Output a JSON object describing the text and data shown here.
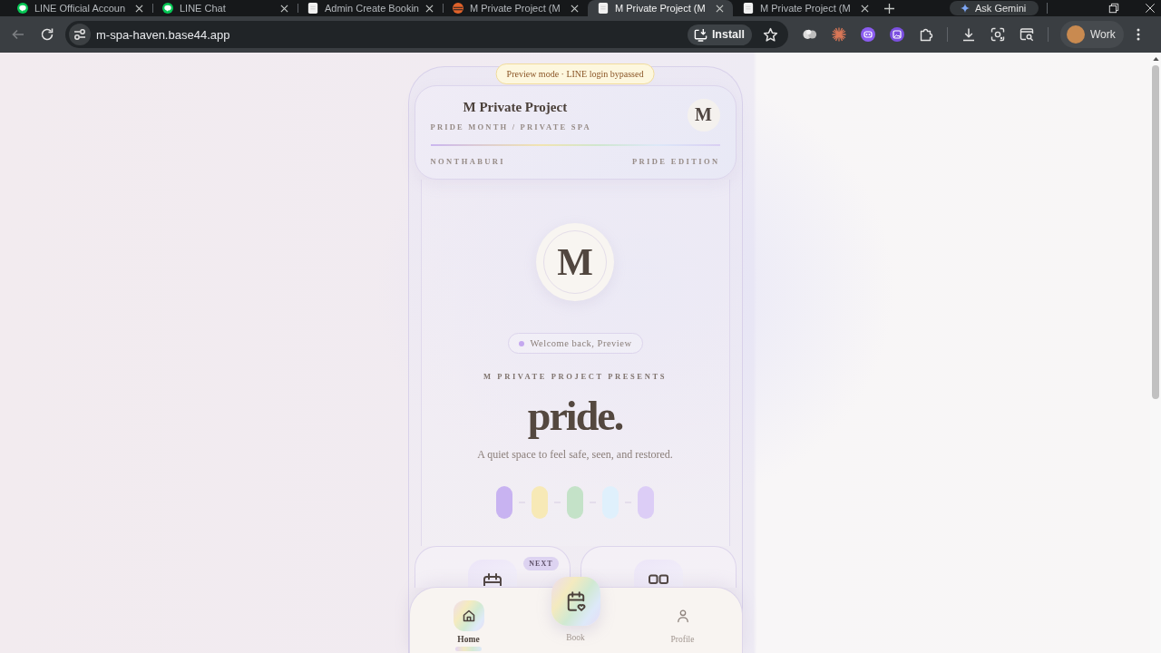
{
  "browser": {
    "tabs": [
      {
        "title": "LINE Official Accoun",
        "kind": "chat",
        "selected": false
      },
      {
        "title": "LINE Chat",
        "kind": "chat",
        "selected": false
      },
      {
        "title": "Admin Create Bookin",
        "kind": "page",
        "selected": false
      },
      {
        "title": "M Private Project (M",
        "kind": "site",
        "selected": false
      },
      {
        "title": "M Private Project (M",
        "kind": "page",
        "selected": true
      },
      {
        "title": "M Private Project (M",
        "kind": "page",
        "selected": false
      }
    ],
    "gemini_button": "Ask Gemini",
    "address": "m-spa-haven.base44.app",
    "install_button": "Install",
    "profile": "Work"
  },
  "app": {
    "preview_banner": "Preview mode · LINE login bypassed",
    "header": {
      "title": "M Private Project",
      "subtitle": "PRIDE MONTH / PRIVATE SPA",
      "monogram": "M",
      "location": "NONTHABURI",
      "edition": "PRIDE EDITION"
    },
    "logo": "M",
    "greeting": "Welcome back, Preview",
    "eyebrow": "M PRIVATE PROJECT PRESENTS",
    "headline": "pride.",
    "tagline": "A quiet space to feel safe, seen, and restored.",
    "stripes": [
      {
        "color": "#c8b3f1"
      },
      {
        "color": "#f7e9b6"
      },
      {
        "color": "#c4e2c8"
      },
      {
        "color": "#dff0fc"
      },
      {
        "color": "#dccdf6"
      }
    ],
    "cards": [
      {
        "kind": "calendar",
        "badge": "NEXT"
      },
      {
        "kind": "squares"
      }
    ],
    "nav": [
      {
        "label": "Home",
        "kind": "tab",
        "selected": true
      },
      {
        "label": "Book",
        "kind": "action",
        "selected": false
      },
      {
        "label": "Profile",
        "kind": "tab",
        "selected": false
      }
    ]
  }
}
